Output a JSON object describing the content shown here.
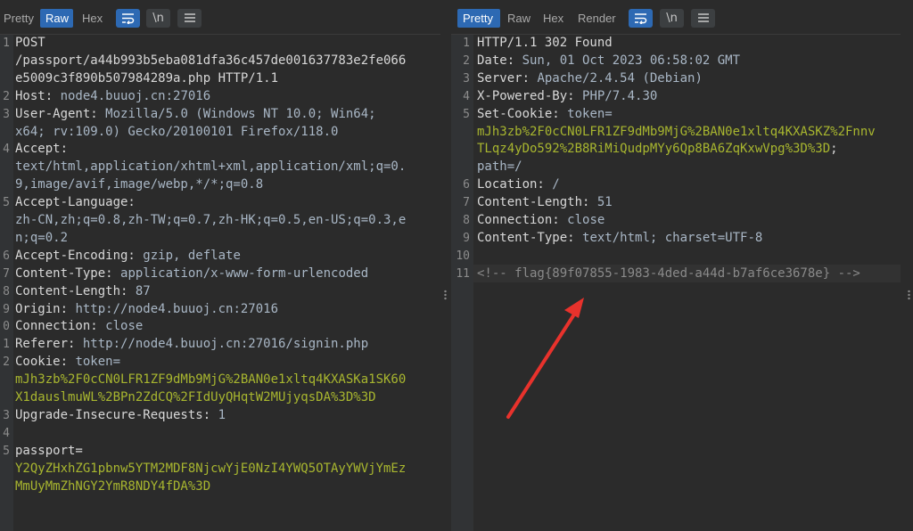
{
  "left": {
    "tabs": [
      {
        "label": "Pretty",
        "active": false
      },
      {
        "label": "Raw",
        "active": true
      },
      {
        "label": "Hex",
        "active": false
      }
    ],
    "lines": [
      {
        "num": "1",
        "k": "POST",
        "v": ""
      },
      {
        "num": "",
        "k": "/passport/a44b993b5eba081dfa36c457de001637783e2fe066",
        "v": ""
      },
      {
        "num": "",
        "k": "e5009c3f890b507984289a.php HTTP/1.1",
        "v": ""
      },
      {
        "num": "2",
        "k": "Host: ",
        "v": "node4.buuoj.cn:27016"
      },
      {
        "num": "3",
        "k": "User-Agent: ",
        "v": "Mozilla/5.0 (Windows NT 10.0; Win64;"
      },
      {
        "num": "",
        "k": "",
        "v": "x64; rv:109.0) Gecko/20100101 Firefox/118.0"
      },
      {
        "num": "4",
        "k": "Accept:",
        "v": ""
      },
      {
        "num": "",
        "k": "",
        "v": "text/html,application/xhtml+xml,application/xml;q=0."
      },
      {
        "num": "",
        "k": "",
        "v": "9,image/avif,image/webp,*/*;q=0.8"
      },
      {
        "num": "5",
        "k": "Accept-Language:",
        "v": ""
      },
      {
        "num": "",
        "k": "",
        "v": "zh-CN,zh;q=0.8,zh-TW;q=0.7,zh-HK;q=0.5,en-US;q=0.3,e"
      },
      {
        "num": "",
        "k": "",
        "v": "n;q=0.2"
      },
      {
        "num": "6",
        "k": "Accept-Encoding: ",
        "v": "gzip, deflate"
      },
      {
        "num": "7",
        "k": "Content-Type: ",
        "v": "application/x-www-form-urlencoded"
      },
      {
        "num": "8",
        "k": "Content-Length: ",
        "v": "87"
      },
      {
        "num": "9",
        "k": "Origin: ",
        "v": "http://node4.buuoj.cn:27016"
      },
      {
        "num": "0",
        "k": "Connection: ",
        "v": "close"
      },
      {
        "num": "1",
        "k": "Referer: ",
        "v": "http://node4.buuoj.cn:27016/signin.php"
      },
      {
        "num": "2",
        "k": "Cookie: ",
        "v": "token="
      },
      {
        "num": "",
        "k": "",
        "v": "",
        "g": "mJh3zb%2F0cCN0LFR1ZF9dMb9MjG%2BAN0e1xltq4KXASKa1SK60"
      },
      {
        "num": "",
        "k": "",
        "v": "",
        "g": "X1dauslmuWL%2BPn2ZdCQ%2FIdUyQHqtW2MUjyqsDA%3D%3D"
      },
      {
        "num": "3",
        "k": "Upgrade-Insecure-Requests: ",
        "v": "1"
      },
      {
        "num": "4",
        "k": "",
        "v": ""
      },
      {
        "num": "5",
        "k": "passport=",
        "v": ""
      },
      {
        "num": "",
        "k": "",
        "v": "",
        "g": "Y2QyZHxhZG1pbnw5YTM2MDF8NjcwYjE0NzI4YWQ5OTAyYWVjYmEz"
      },
      {
        "num": "",
        "k": "",
        "v": "",
        "g": "MmUyMmZhNGY2YmR8NDY4fDA%3D"
      }
    ]
  },
  "right": {
    "tabs": [
      {
        "label": "Pretty",
        "active": true
      },
      {
        "label": "Raw",
        "active": false
      },
      {
        "label": "Hex",
        "active": false
      },
      {
        "label": "Render",
        "active": false
      }
    ],
    "lines": [
      {
        "num": "1",
        "k": "HTTP/1.1 302 Found",
        "v": ""
      },
      {
        "num": "2",
        "k": "Date: ",
        "v": "Sun, 01 Oct 2023 06:58:02 GMT"
      },
      {
        "num": "3",
        "k": "Server: ",
        "v": "Apache/2.4.54 (Debian)"
      },
      {
        "num": "4",
        "k": "X-Powered-By: ",
        "v": "PHP/7.4.30"
      },
      {
        "num": "5",
        "k": "Set-Cookie: ",
        "v": "token="
      },
      {
        "num": "",
        "k": "",
        "v": "",
        "g": "mJh3zb%2F0cCN0LFR1ZF9dMb9MjG%2BAN0e1xltq4KXASKZ%2Fnnv"
      },
      {
        "num": "",
        "k": "",
        "v": "",
        "g": "TLqz4yDo592%2B8RiMiQudpMYy6Qp8BA6ZqKxwVpg%3D%3D",
        "t": ";"
      },
      {
        "num": "",
        "k": "",
        "v": "path=/"
      },
      {
        "num": "6",
        "k": "Location: ",
        "v": "/"
      },
      {
        "num": "7",
        "k": "Content-Length: ",
        "v": "51"
      },
      {
        "num": "8",
        "k": "Connection: ",
        "v": "close"
      },
      {
        "num": "9",
        "k": "Content-Type: ",
        "v": "text/html; charset=UTF-8"
      },
      {
        "num": "10",
        "k": "",
        "v": ""
      },
      {
        "num": "11",
        "k": "",
        "v": "",
        "c": "<!-- flag{89f07855-1983-4ded-a44d-b7af6ce3678e} -->"
      }
    ]
  },
  "colors": {
    "accent": "#2d69b3",
    "arrow": "#e8322c",
    "value_green": "#a8b62f"
  },
  "icons": [
    "wrap-icon",
    "newline-icon",
    "menu-icon"
  ]
}
